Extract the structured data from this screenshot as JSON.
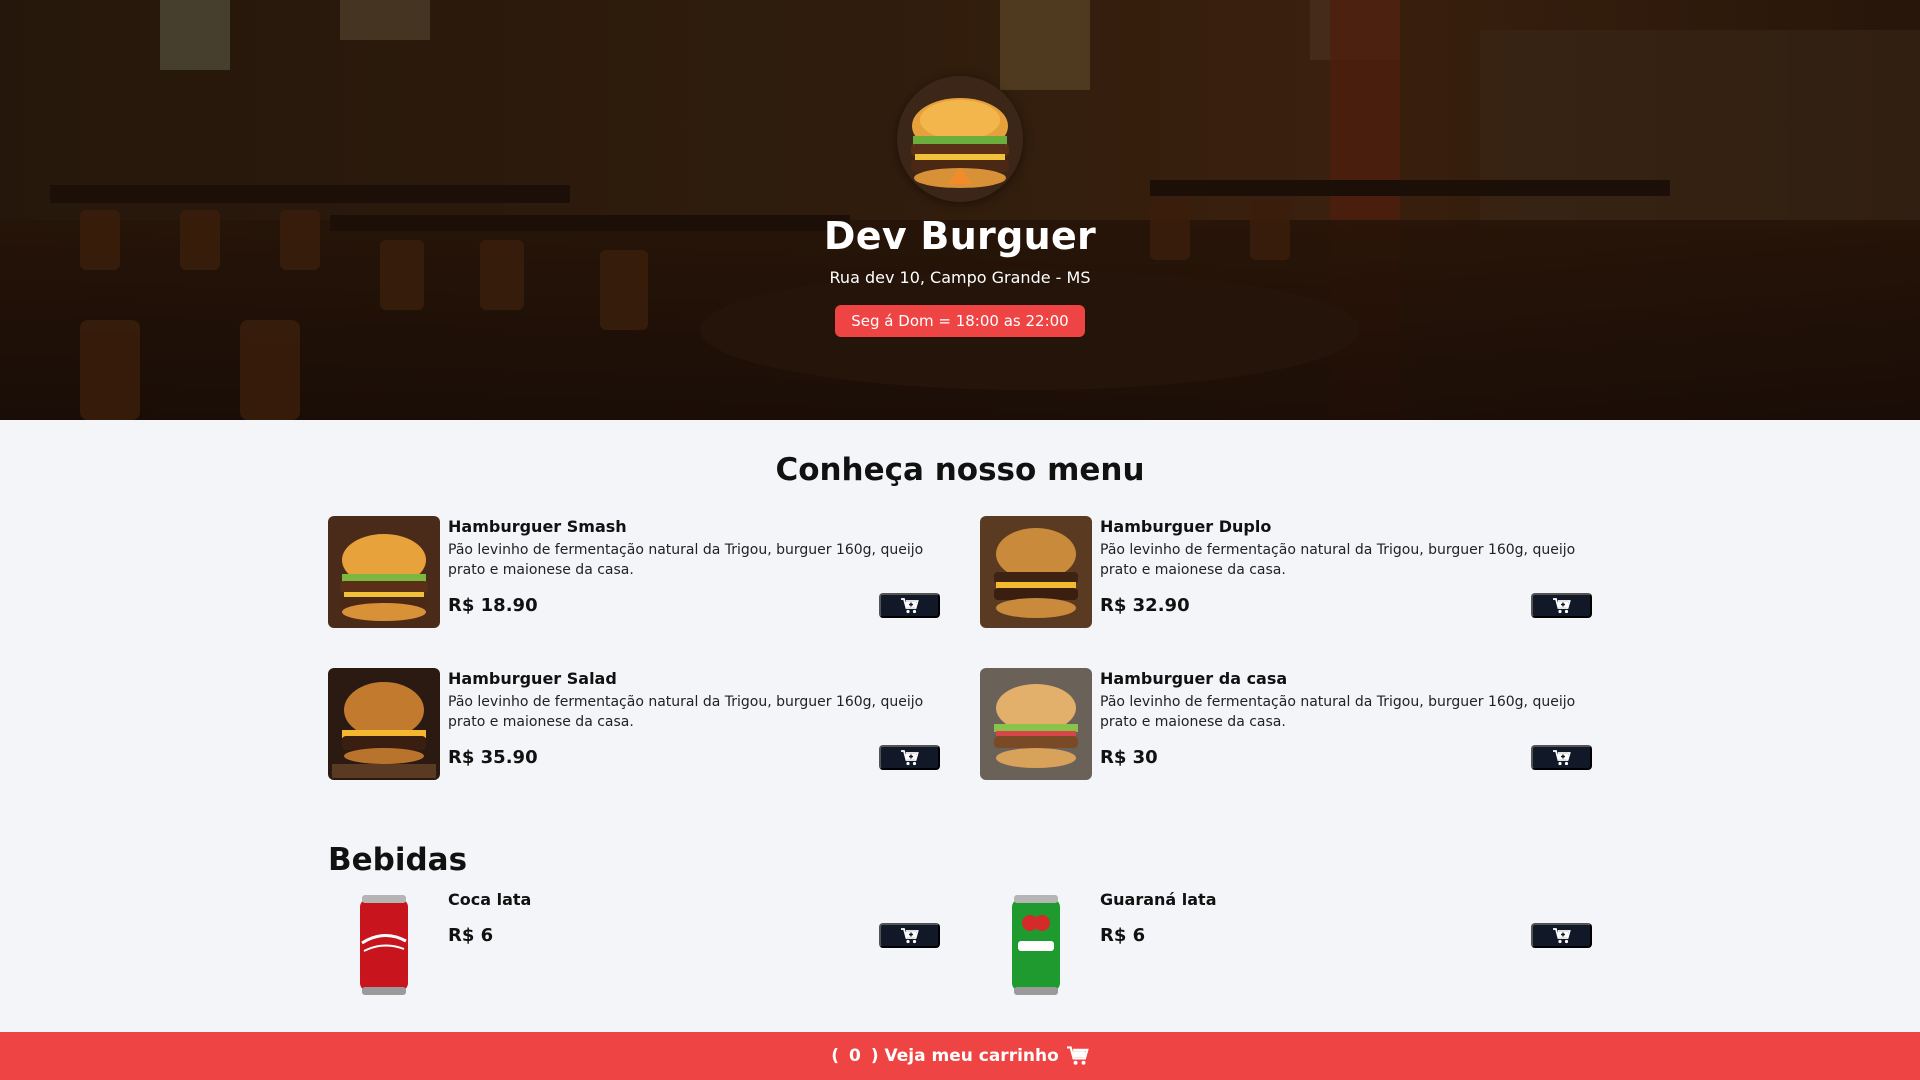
{
  "header": {
    "title": "Dev Burguer",
    "address": "Rua dev 10, Campo Grande - MS",
    "hours": "Seg á Dom = 18:00 as 22:00"
  },
  "menu": {
    "title": "Conheça nosso menu",
    "items": [
      {
        "name": "Hamburguer Smash",
        "description": "Pão levinho de fermentação natural da Trigou, burguer 160g, queijo prato e maionese da casa.",
        "price": "R$ 18.90"
      },
      {
        "name": "Hamburguer Duplo",
        "description": "Pão levinho de fermentação natural da Trigou, burguer 160g, queijo prato e maionese da casa.",
        "price": "R$ 32.90"
      },
      {
        "name": "Hamburguer Salad",
        "description": "Pão levinho de fermentação natural da Trigou, burguer 160g, queijo prato e maionese da casa.",
        "price": "R$ 35.90"
      },
      {
        "name": "Hamburguer da casa",
        "description": "Pão levinho de fermentação natural da Trigou, burguer 160g, queijo prato e maionese da casa.",
        "price": "R$ 30"
      }
    ]
  },
  "drinks": {
    "title": "Bebidas",
    "items": [
      {
        "name": "Coca lata",
        "price": "R$ 6"
      },
      {
        "name": "Guaraná lata",
        "price": "R$ 6"
      }
    ]
  },
  "footer": {
    "open_paren": "(",
    "count": "0",
    "label": ") Veja meu carrinho"
  },
  "colors": {
    "accent": "#ef4444",
    "button": "#111827",
    "background": "#f4f5f8"
  },
  "icons": [
    "cart-plus-icon",
    "cart-icon"
  ]
}
